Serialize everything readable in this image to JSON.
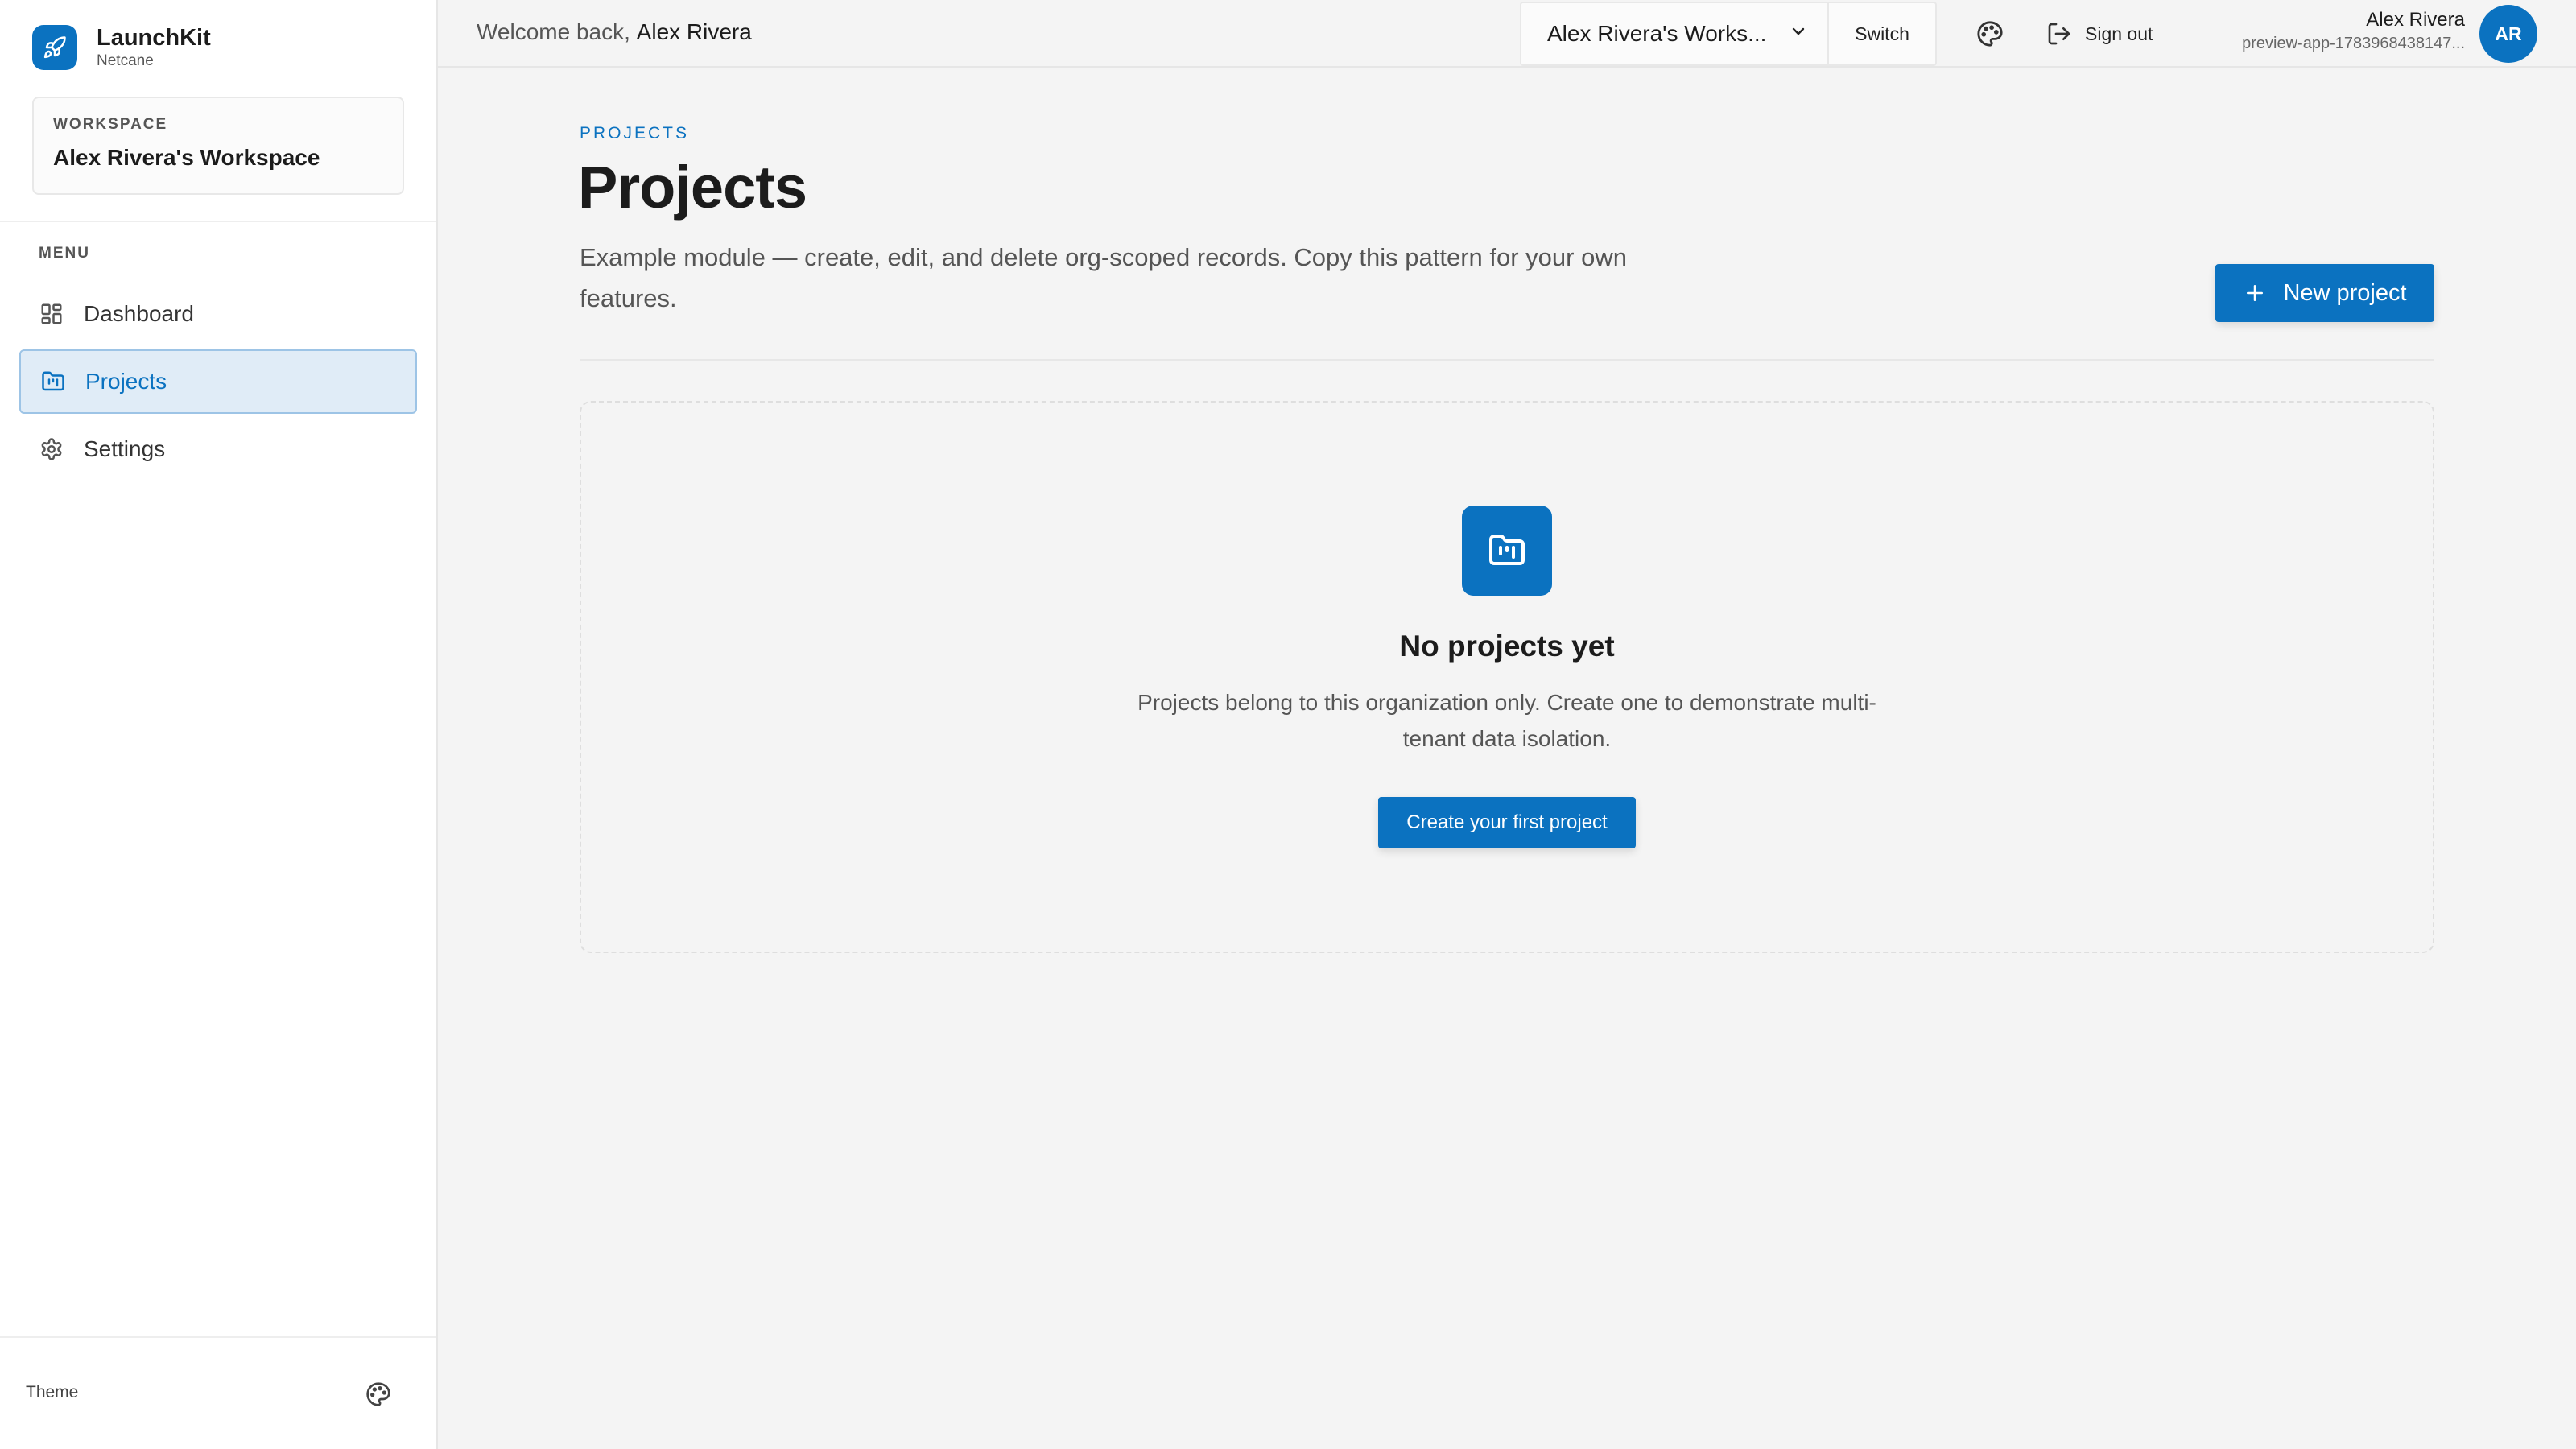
{
  "app": {
    "name": "LaunchKit",
    "org": "Netcane"
  },
  "workspace_card": {
    "label": "WORKSPACE",
    "name": "Alex Rivera's Workspace"
  },
  "menu": {
    "label": "MENU",
    "items": [
      {
        "label": "Dashboard",
        "icon": "dashboard-icon",
        "active": false
      },
      {
        "label": "Projects",
        "icon": "folder-icon",
        "active": true
      },
      {
        "label": "Settings",
        "icon": "gear-icon",
        "active": false
      }
    ]
  },
  "sidebar_footer": {
    "theme_label": "Theme",
    "theme_icon": "palette-icon"
  },
  "topbar": {
    "welcome_prefix": "Welcome back, ",
    "welcome_name": "Alex Rivera",
    "workspace_select": "Alex Rivera's Works...",
    "switch_label": "Switch",
    "signout_label": "Sign out",
    "user_name": "Alex Rivera",
    "user_org": "preview-app-1783968438147...",
    "avatar_initials": "AR"
  },
  "page": {
    "eyebrow": "PROJECTS",
    "title": "Projects",
    "description": "Example module — create, edit, and delete org-scoped records. Copy this pattern for your own features.",
    "new_button": "New project"
  },
  "empty_state": {
    "title": "No projects yet",
    "description": "Projects belong to this organization only. Create one to demonstrate multi-tenant data isolation.",
    "button": "Create your first project"
  },
  "colors": {
    "accent": "#0b72c0",
    "active_bg": "#e0ecf7",
    "page_bg": "#f4f4f4"
  }
}
